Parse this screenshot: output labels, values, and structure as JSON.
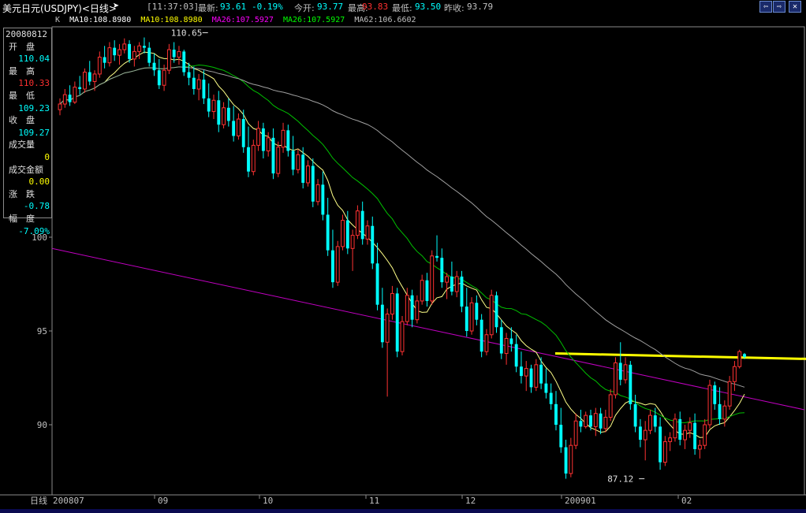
{
  "header": {
    "title": "美元日元(USDJPY)<日线>",
    "time": "[11:37:03]",
    "latest_label": "最新:",
    "latest_value": "93.61",
    "change_pct": "-0.19%",
    "open_label": "今开:",
    "open_value": "93.77",
    "high_label": "最高:",
    "high_value": "93.83",
    "low_label": "最低:",
    "low_value": "93.50",
    "prev_close_label": "昨收:",
    "prev_close_value": "93.79",
    "buttons": [
      "⇦",
      "⇨",
      "✕"
    ]
  },
  "ma_legend": {
    "k": "K",
    "items": [
      {
        "text": "MA10:108.8980",
        "color": "#ffffff"
      },
      {
        "text": "MA10:108.8980",
        "color": "#ffff00"
      },
      {
        "text": "MA26:107.5927",
        "color": "#ff00ff"
      },
      {
        "text": "MA26:107.5927",
        "color": "#00ff00"
      },
      {
        "text": "MA62:106.6602",
        "color": "#c0c0c0"
      }
    ]
  },
  "info_panel": {
    "date": "20080812",
    "rows": [
      {
        "label": "开　盘",
        "value": "110.04",
        "color": "#00ffff"
      },
      {
        "label": "最　高",
        "value": "110.33",
        "color": "#ff3030"
      },
      {
        "label": "最　低",
        "value": "109.23",
        "color": "#00ffff"
      },
      {
        "label": "收　盘",
        "value": "109.27",
        "color": "#00ffff"
      },
      {
        "label": "成交量",
        "value": "0",
        "color": "#ffff00"
      },
      {
        "label": "成交金额",
        "value": "0.00",
        "color": "#ffff00"
      },
      {
        "label": "涨　跌",
        "value": "-0.78",
        "color": "#00ffff"
      },
      {
        "label": "幅　度",
        "value": "-7.09%",
        "color": "#00ffff"
      }
    ]
  },
  "x_axis": {
    "period_label": "日线",
    "month_labels": [
      "200807",
      "09",
      "10",
      "11",
      "12",
      "200901",
      "02"
    ]
  },
  "chart_data": {
    "type": "candlestick",
    "title": "美元日元(USDJPY)<日线>",
    "ylim": [
      85.8,
      112
    ],
    "yticks": [
      90,
      95,
      100
    ],
    "ytick_labels": [
      "90",
      "95",
      "100"
    ],
    "annotations": [
      {
        "text": "110.65",
        "date_index": 30,
        "value": 110.65
      },
      {
        "text": "87.12",
        "date_index": 118,
        "value": 87.12
      }
    ],
    "trend_line": {
      "from_index": 0,
      "from_value": 99.4,
      "to_index": 166,
      "to_value": 90.8
    },
    "arrow": {
      "from_index": 100,
      "value": 93.8,
      "to_index": 166,
      "to_value": 93.4
    },
    "candles": [
      [
        0,
        106.8,
        107.4,
        106.5,
        107.1
      ],
      [
        1,
        107.1,
        107.9,
        106.9,
        107.6
      ],
      [
        2,
        107.6,
        108.1,
        107.0,
        107.2
      ],
      [
        3,
        107.2,
        108.3,
        107.1,
        108.0
      ],
      [
        4,
        108.0,
        108.6,
        107.6,
        107.9
      ],
      [
        5,
        107.9,
        109.0,
        107.7,
        108.8
      ],
      [
        6,
        108.8,
        109.4,
        108.1,
        108.3
      ],
      [
        7,
        108.3,
        108.9,
        107.8,
        108.7
      ],
      [
        8,
        108.7,
        109.9,
        108.5,
        109.6
      ],
      [
        9,
        109.6,
        110.2,
        109.0,
        109.3
      ],
      [
        10,
        109.3,
        110.4,
        109.1,
        110.1
      ],
      [
        11,
        110.1,
        110.5,
        109.4,
        109.7
      ],
      [
        12,
        109.7,
        110.3,
        109.2,
        110.0
      ],
      [
        13,
        110.0,
        110.6,
        109.8,
        110.3
      ],
      [
        14,
        110.3,
        110.5,
        109.3,
        109.5
      ],
      [
        15,
        109.5,
        110.2,
        109.1,
        109.9
      ],
      [
        16,
        109.9,
        110.4,
        109.5,
        110.2
      ],
      [
        17,
        110.2,
        110.65,
        109.8,
        110.1
      ],
      [
        18,
        110.1,
        110.4,
        109.1,
        109.3
      ],
      [
        19,
        109.3,
        109.8,
        108.6,
        108.9
      ],
      [
        20,
        108.9,
        109.5,
        107.9,
        108.1
      ],
      [
        21,
        108.1,
        109.2,
        107.8,
        108.9
      ],
      [
        22,
        108.9,
        110.3,
        108.7,
        110.0
      ],
      [
        23,
        110.0,
        110.4,
        109.3,
        109.6
      ],
      [
        24,
        109.6,
        110.2,
        109.2,
        109.9
      ],
      [
        25,
        109.9,
        110.0,
        108.6,
        108.8
      ],
      [
        26,
        108.8,
        109.3,
        108.1,
        108.5
      ],
      [
        27,
        108.5,
        109.1,
        107.6,
        107.9
      ],
      [
        28,
        107.9,
        108.7,
        107.3,
        108.4
      ],
      [
        29,
        108.4,
        108.9,
        107.1,
        107.4
      ],
      [
        30,
        107.4,
        108.2,
        106.4,
        106.7
      ],
      [
        31,
        106.7,
        107.6,
        106.3,
        107.3
      ],
      [
        32,
        107.3,
        107.8,
        105.6,
        106.0
      ],
      [
        33,
        106.0,
        107.2,
        105.8,
        106.9
      ],
      [
        34,
        106.9,
        107.4,
        105.9,
        106.2
      ],
      [
        35,
        106.2,
        107.0,
        105.1,
        105.4
      ],
      [
        36,
        105.4,
        106.6,
        105.2,
        106.3
      ],
      [
        37,
        106.3,
        106.8,
        104.5,
        104.8
      ],
      [
        38,
        104.8,
        105.9,
        103.2,
        103.5
      ],
      [
        39,
        103.5,
        105.2,
        103.3,
        104.9
      ],
      [
        40,
        104.9,
        106.2,
        104.6,
        105.8
      ],
      [
        41,
        105.8,
        106.1,
        104.2,
        104.6
      ],
      [
        42,
        104.6,
        105.6,
        104.3,
        105.3
      ],
      [
        43,
        105.3,
        105.8,
        103.1,
        103.4
      ],
      [
        44,
        103.4,
        105.1,
        103.2,
        104.8
      ],
      [
        45,
        104.8,
        106.1,
        104.5,
        105.7
      ],
      [
        46,
        105.7,
        106.0,
        104.3,
        104.6
      ],
      [
        47,
        104.6,
        105.4,
        103.3,
        103.6
      ],
      [
        48,
        103.6,
        104.7,
        103.4,
        104.4
      ],
      [
        49,
        104.4,
        104.8,
        102.6,
        102.9
      ],
      [
        50,
        102.9,
        104.1,
        102.7,
        103.8
      ],
      [
        51,
        103.8,
        104.2,
        101.6,
        101.9
      ],
      [
        52,
        101.9,
        103.1,
        101.7,
        102.8
      ],
      [
        53,
        102.8,
        103.5,
        100.9,
        101.2
      ],
      [
        54,
        101.2,
        102.1,
        99.0,
        99.3
      ],
      [
        55,
        99.3,
        100.4,
        97.3,
        97.6
      ],
      [
        56,
        97.6,
        99.8,
        97.4,
        99.5
      ],
      [
        57,
        99.5,
        101.2,
        99.3,
        100.9
      ],
      [
        58,
        100.9,
        101.4,
        99.1,
        99.4
      ],
      [
        59,
        99.4,
        100.4,
        98.2,
        100.1
      ],
      [
        60,
        100.1,
        101.7,
        99.9,
        101.4
      ],
      [
        61,
        101.4,
        101.9,
        99.6,
        99.9
      ],
      [
        62,
        99.9,
        100.9,
        99.6,
        100.6
      ],
      [
        63,
        100.6,
        101.1,
        98.3,
        98.6
      ],
      [
        64,
        98.6,
        99.7,
        96.1,
        96.4
      ],
      [
        65,
        96.4,
        97.3,
        94.1,
        94.4
      ],
      [
        66,
        94.4,
        96.2,
        91.5,
        95.9
      ],
      [
        67,
        95.9,
        97.4,
        95.6,
        97.0
      ],
      [
        68,
        97.0,
        97.3,
        93.6,
        93.9
      ],
      [
        69,
        93.9,
        95.8,
        93.7,
        95.5
      ],
      [
        70,
        95.5,
        97.3,
        95.3,
        96.9
      ],
      [
        71,
        96.9,
        97.2,
        95.2,
        95.6
      ],
      [
        72,
        95.6,
        96.9,
        95.4,
        96.6
      ],
      [
        73,
        96.6,
        98.0,
        96.4,
        97.7
      ],
      [
        74,
        97.7,
        98.1,
        96.3,
        96.6
      ],
      [
        75,
        96.6,
        99.3,
        96.4,
        99.0
      ],
      [
        76,
        99.0,
        100.1,
        98.7,
        98.9
      ],
      [
        77,
        98.9,
        99.4,
        97.3,
        97.6
      ],
      [
        78,
        97.6,
        98.1,
        96.7,
        97.9
      ],
      [
        79,
        97.9,
        98.7,
        96.9,
        97.1
      ],
      [
        80,
        97.1,
        98.2,
        96.8,
        97.9
      ],
      [
        81,
        97.9,
        98.2,
        96.0,
        96.3
      ],
      [
        82,
        96.3,
        97.3,
        94.7,
        95.0
      ],
      [
        83,
        95.0,
        96.8,
        94.8,
        96.5
      ],
      [
        84,
        96.5,
        96.9,
        95.3,
        95.6
      ],
      [
        85,
        95.6,
        95.9,
        93.6,
        93.9
      ],
      [
        86,
        93.9,
        95.1,
        93.7,
        94.8
      ],
      [
        87,
        94.8,
        97.2,
        94.6,
        96.9
      ],
      [
        88,
        96.9,
        97.1,
        94.9,
        95.2
      ],
      [
        89,
        95.2,
        95.6,
        93.5,
        93.8
      ],
      [
        90,
        93.8,
        94.9,
        93.2,
        94.6
      ],
      [
        91,
        94.6,
        95.2,
        93.9,
        94.3
      ],
      [
        92,
        94.3,
        94.8,
        92.8,
        93.1
      ],
      [
        93,
        93.1,
        93.9,
        92.2,
        92.6
      ],
      [
        94,
        92.6,
        93.4,
        91.8,
        93.0
      ],
      [
        95,
        93.0,
        93.2,
        91.7,
        92.0
      ],
      [
        96,
        92.0,
        93.5,
        91.8,
        93.2
      ],
      [
        97,
        93.2,
        93.6,
        91.9,
        92.2
      ],
      [
        98,
        92.2,
        93.0,
        91.4,
        91.7
      ],
      [
        99,
        91.7,
        92.2,
        90.8,
        91.1
      ],
      [
        100,
        91.1,
        91.8,
        89.7,
        90.0
      ],
      [
        101,
        90.0,
        90.9,
        88.5,
        88.8
      ],
      [
        102,
        88.8,
        89.2,
        87.12,
        87.4
      ],
      [
        103,
        87.4,
        89.3,
        87.2,
        88.9
      ],
      [
        104,
        88.9,
        90.6,
        88.7,
        90.2
      ],
      [
        105,
        90.2,
        90.8,
        89.6,
        89.9
      ],
      [
        106,
        89.9,
        90.7,
        89.8,
        90.5
      ],
      [
        107,
        90.5,
        90.8,
        89.7,
        89.9
      ],
      [
        108,
        89.9,
        90.9,
        89.4,
        90.6
      ],
      [
        109,
        90.6,
        90.9,
        89.5,
        89.8
      ],
      [
        110,
        89.8,
        90.8,
        89.6,
        90.4
      ],
      [
        111,
        90.4,
        91.9,
        90.2,
        91.6
      ],
      [
        112,
        91.6,
        93.6,
        91.4,
        93.3
      ],
      [
        113,
        93.3,
        94.4,
        92.1,
        92.4
      ],
      [
        114,
        92.4,
        93.6,
        92.2,
        93.2
      ],
      [
        115,
        93.2,
        93.4,
        90.8,
        91.1
      ],
      [
        116,
        91.1,
        91.6,
        89.6,
        89.9
      ],
      [
        117,
        89.9,
        90.3,
        88.8,
        89.2
      ],
      [
        118,
        89.2,
        90.2,
        88.1,
        89.7
      ],
      [
        119,
        89.7,
        90.8,
        89.5,
        90.5
      ],
      [
        120,
        90.5,
        90.9,
        89.6,
        89.9
      ],
      [
        121,
        89.9,
        90.4,
        87.6,
        88.0
      ],
      [
        122,
        88.0,
        89.4,
        87.8,
        89.1
      ],
      [
        123,
        89.1,
        89.6,
        88.6,
        89.3
      ],
      [
        124,
        89.3,
        90.6,
        89.1,
        90.3
      ],
      [
        125,
        90.3,
        90.7,
        88.9,
        89.2
      ],
      [
        126,
        89.2,
        90.0,
        88.7,
        89.7
      ],
      [
        127,
        89.7,
        90.4,
        89.3,
        90.1
      ],
      [
        128,
        90.1,
        90.6,
        88.4,
        88.7
      ],
      [
        129,
        88.7,
        89.2,
        88.2,
        88.9
      ],
      [
        130,
        88.9,
        90.3,
        88.7,
        90.0
      ],
      [
        131,
        90.0,
        92.4,
        89.8,
        92.1
      ],
      [
        132,
        92.1,
        92.3,
        90.8,
        91.1
      ],
      [
        133,
        91.1,
        92.0,
        90.0,
        90.3
      ],
      [
        134,
        90.3,
        91.3,
        89.9,
        91.0
      ],
      [
        135,
        91.0,
        92.6,
        90.8,
        92.3
      ],
      [
        136,
        92.3,
        93.4,
        91.8,
        93.1
      ],
      [
        137,
        93.1,
        94.0,
        93.0,
        93.9
      ],
      [
        138,
        93.77,
        93.83,
        93.5,
        93.61
      ]
    ]
  }
}
